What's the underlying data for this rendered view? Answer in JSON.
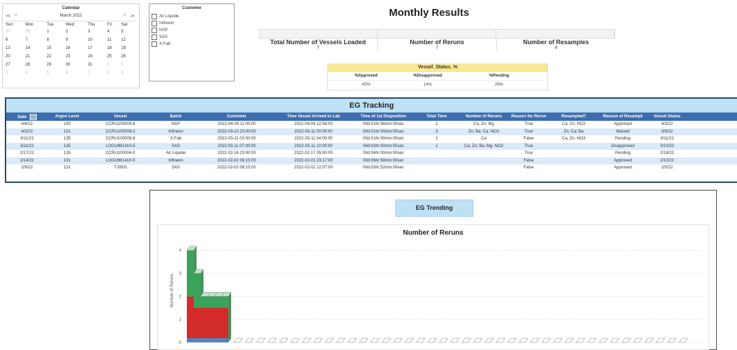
{
  "calendar": {
    "title": "Calendar",
    "month": "March 2022",
    "nav": {
      "prev_year": "≪",
      "prev": "<",
      "next": ">",
      "next_year": "≫"
    },
    "weekdays": [
      "Sun",
      "Mon",
      "Tue",
      "Wed",
      "Thu",
      "Fri",
      "Sat"
    ],
    "weeks": [
      [
        "27",
        "28",
        "1",
        "2",
        "3",
        "4",
        "5"
      ],
      [
        "6",
        "7",
        "8",
        "9",
        "10",
        "11",
        "12"
      ],
      [
        "13",
        "14",
        "15",
        "16",
        "17",
        "18",
        "19"
      ],
      [
        "20",
        "21",
        "22",
        "23",
        "24",
        "25",
        "26"
      ],
      [
        "27",
        "28",
        "29",
        "30",
        "31",
        "1",
        "2"
      ],
      [
        "3",
        "4",
        "5",
        "6",
        "7",
        "8",
        "9"
      ]
    ]
  },
  "customer": {
    "title": "Customer",
    "options": [
      "Air Liquide",
      "Infineon",
      "NXP",
      "SAS",
      "X-Fab"
    ]
  },
  "monthly": {
    "title": "Monthly Results",
    "kpis": [
      {
        "label": "Total Number of Vessels Loaded",
        "value": "7"
      },
      {
        "label": "Number of Reruns",
        "value": "7"
      },
      {
        "label": "Number of Resamples",
        "value": "4"
      }
    ],
    "status": {
      "title": "Vessel_Status_%",
      "headers": [
        "%Approved",
        "%Disapproved",
        "%Pending"
      ],
      "values": [
        "43%",
        "14%",
        "29%"
      ]
    }
  },
  "tracking": {
    "title": "EG Tracking",
    "columns": [
      "Date",
      "Argon Level",
      "Vessel",
      "Batch",
      "Customer",
      "Time Vessel Arrived to Lab",
      "Time of 1st Disposition",
      "Total Time",
      "Number of Reruns",
      "Reason for Rerun",
      "Resampled?",
      "Reason of Resampli",
      "Vessel Status"
    ],
    "rows": [
      [
        "4/4/22",
        "150",
        "CCRU100009-8",
        "NXP",
        "2022-04-04 11:00:00",
        "2022-04-04 12:56:00",
        "00d:01hr:56min:00sec",
        "2",
        "Ca; Zn; Mg",
        "True",
        "Ca; Zn; NO3",
        "Approved",
        "4/3/22"
      ],
      [
        "4/3/22",
        "131",
        "CCRU100009-2",
        "Infineon",
        "2022-03-10 23:00:00",
        "2022-03-11 00:00:00",
        "00d:01hr:00min:00sec",
        "3",
        "Zn; Ba; Ca; NO3",
        "True",
        "Zn; Ca; Ba",
        "Waived",
        "3/9/22"
      ],
      [
        "3/11/22",
        "135",
        "CCRU100009-8",
        "X-Fab",
        "2022-03-11 03:00:00",
        "2022-03-11 04:00:00",
        "00d:01hr:00min:00sec",
        "1",
        "Ca",
        "False",
        "Ca; Zn; NO3",
        "Pending",
        "3/11/22"
      ],
      [
        "3/11/22",
        "135",
        "LOGU961410-5",
        "SAS",
        "2022-03-11 07:00:00",
        "2022-03-11 10:00:00",
        "00d:03hr:00min:00sec",
        "1",
        "Ca; Zn; Ba; Mg; NO3",
        "True",
        "",
        "Disapproved",
        "3/10/22"
      ],
      [
        "2/17/22",
        "135",
        "CCRU100004-0",
        "Air Liquide",
        "2022-02-16 23:00:00",
        "2022-02-17 05:00:00",
        "00d:06hr:00min:00sec",
        "",
        "",
        "True",
        "",
        "Pending",
        "2/18/22"
      ],
      [
        "2/14/22",
        "131",
        "LOGU961410-5",
        "Infineon",
        "2022-02-02 06:15:00",
        "2022-02-01 23:17:00",
        "00d:06hr:58min:00sec",
        "",
        "",
        "False",
        "",
        "Approved",
        "2/10/22"
      ],
      [
        "2/9/22",
        "131",
        "T-5603",
        "SAS",
        "2022-02-02 08:15:00",
        "2022-02-02 12:07:00",
        "00d:03hr:52min:00sec",
        "",
        "",
        "False",
        "",
        "Approved",
        "2/5/22"
      ]
    ]
  },
  "trending": {
    "button_label": "EG Trending"
  },
  "chart_data": {
    "type": "bar",
    "title": "Number of Reruns",
    "ylabel": "Number of Reruns",
    "xlabel": "",
    "ylim": [
      0,
      4.5
    ],
    "yticks": [
      "0",
      "1",
      "2",
      "3",
      "4"
    ],
    "stacked": true,
    "colors": {
      "top": "#3aa35a",
      "middle": "#d42b2b",
      "base": "#4a86c8"
    },
    "bars_total": [
      4,
      3,
      2,
      2,
      2,
      2
    ],
    "bars_middle": [
      2,
      1.5,
      1.5,
      1.5,
      1.5,
      1.5
    ],
    "empty_bar_count": 40,
    "grid": true,
    "legend": "none"
  }
}
